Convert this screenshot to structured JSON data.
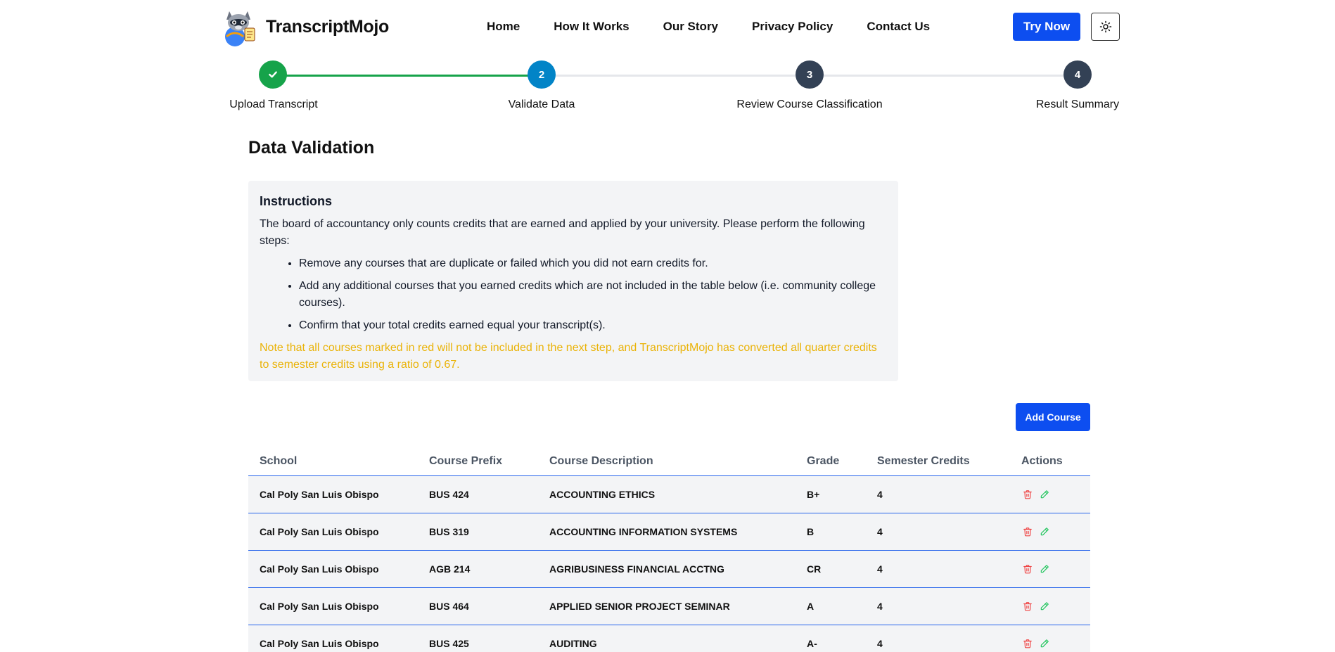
{
  "brand": {
    "name": "TranscriptMojo",
    "logo_icon": "raccoon-mascot-icon"
  },
  "nav": {
    "items": [
      {
        "label": "Home"
      },
      {
        "label": "How It Works"
      },
      {
        "label": "Our Story"
      },
      {
        "label": "Privacy Policy"
      },
      {
        "label": "Contact Us"
      }
    ],
    "try_now_label": "Try Now",
    "theme_icon": "sun-icon"
  },
  "stepper": {
    "active_color": "#16a34a",
    "current_color": "#0284c7",
    "pending_color": "#334155",
    "steps": [
      {
        "number": "✓",
        "label": "Upload Transcript",
        "state": "complete"
      },
      {
        "number": "2",
        "label": "Validate Data",
        "state": "current"
      },
      {
        "number": "3",
        "label": "Review Course Classification",
        "state": "pending"
      },
      {
        "number": "4",
        "label": "Result Summary",
        "state": "pending"
      }
    ]
  },
  "page": {
    "title": "Data Validation"
  },
  "instructions": {
    "title": "Instructions",
    "intro": "The board of accountancy only counts credits that are earned and applied by your university. Please perform the following steps:",
    "steps": [
      "Remove any courses that are duplicate or failed which you did not earn credits for.",
      "Add any additional courses that you earned credits which are not included in the table below (i.e. community college courses).",
      "Confirm that your total credits earned equal your transcript(s)."
    ],
    "note": "Note that all courses marked in red will not be included in the next step, and TranscriptMojo has converted all quarter credits to semester credits using a ratio of 0.67.",
    "note_color": "#eab308"
  },
  "actions": {
    "add_course_label": "Add Course"
  },
  "table": {
    "columns": [
      "School",
      "Course Prefix",
      "Course Description",
      "Grade",
      "Semester Credits",
      "Actions"
    ],
    "rows": [
      {
        "school": "Cal Poly San Luis Obispo",
        "prefix": "BUS 424",
        "description": "ACCOUNTING ETHICS",
        "grade": "B+",
        "credits": "4"
      },
      {
        "school": "Cal Poly San Luis Obispo",
        "prefix": "BUS 319",
        "description": "ACCOUNTING INFORMATION SYSTEMS",
        "grade": "B",
        "credits": "4"
      },
      {
        "school": "Cal Poly San Luis Obispo",
        "prefix": "AGB 214",
        "description": "AGRIBUSINESS FINANCIAL ACCTNG",
        "grade": "CR",
        "credits": "4"
      },
      {
        "school": "Cal Poly San Luis Obispo",
        "prefix": "BUS 464",
        "description": "APPLIED SENIOR PROJECT SEMINAR",
        "grade": "A",
        "credits": "4"
      },
      {
        "school": "Cal Poly San Luis Obispo",
        "prefix": "BUS 425",
        "description": "AUDITING",
        "grade": "A-",
        "credits": "4"
      }
    ],
    "delete_icon": "trash-icon",
    "edit_icon": "pencil-icon",
    "delete_color": "#ef4444",
    "edit_color": "#22c55e"
  }
}
